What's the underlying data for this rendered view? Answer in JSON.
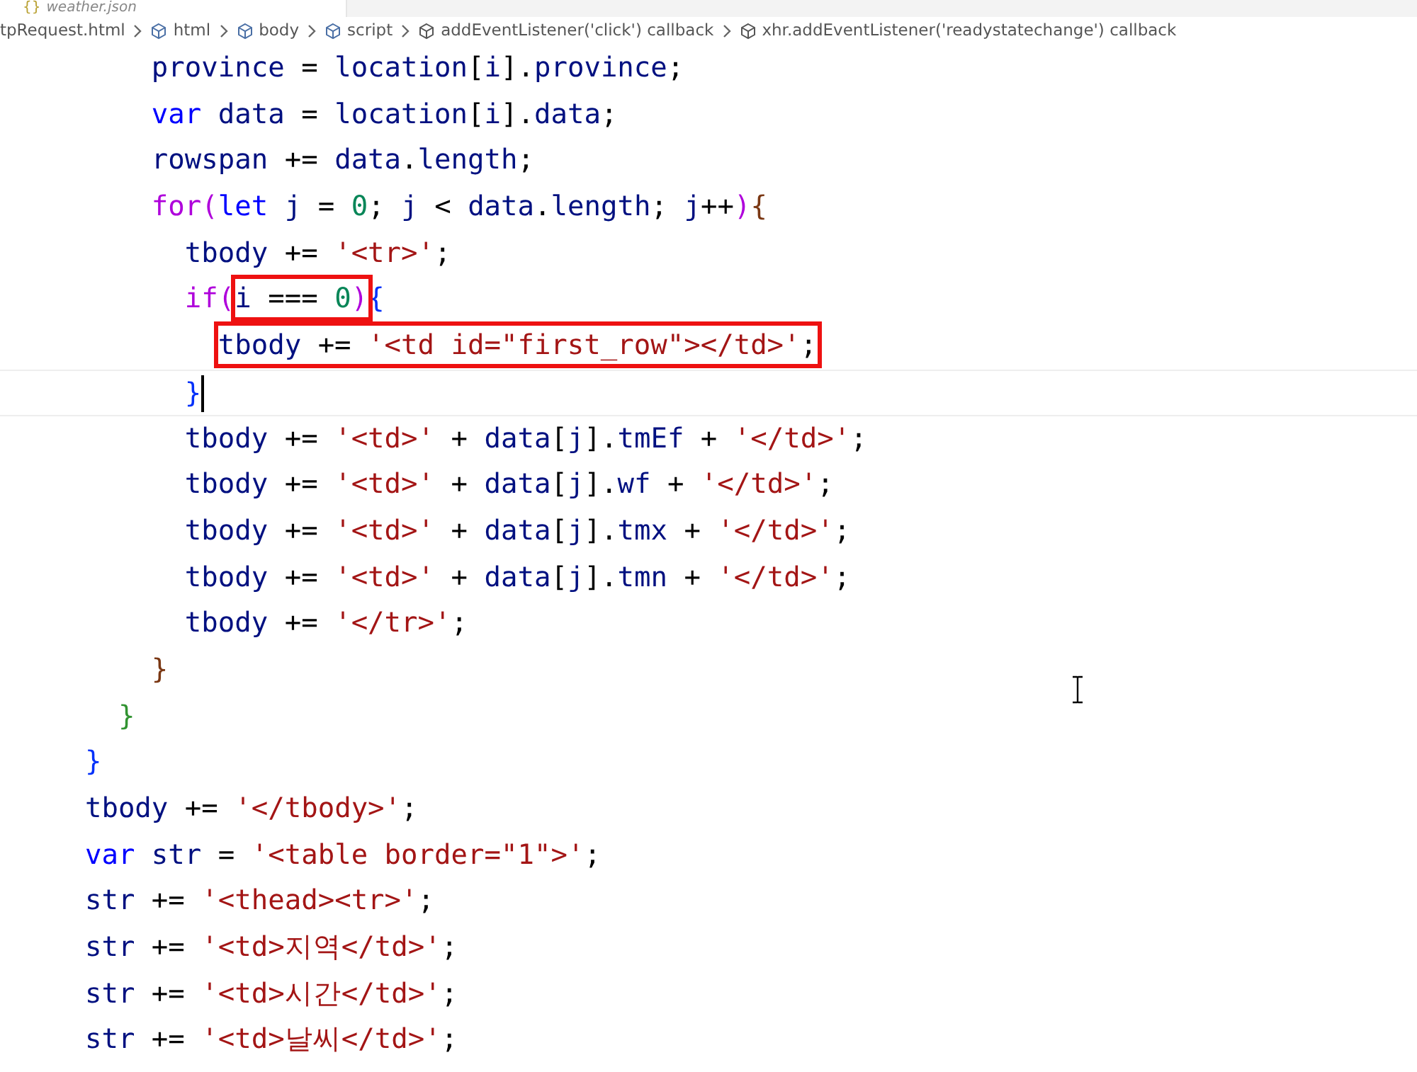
{
  "tab": {
    "icon_text": "{}",
    "label": "weather.json"
  },
  "breadcrumb": [
    {
      "label": "tpRequest.html",
      "kind": "file"
    },
    {
      "label": "html",
      "kind": "symbol"
    },
    {
      "label": "body",
      "kind": "symbol"
    },
    {
      "label": "script",
      "kind": "symbol"
    },
    {
      "label": "addEventListener('click') callback",
      "kind": "method"
    },
    {
      "label": "xhr.addEventListener('readystatechange') callback",
      "kind": "method"
    }
  ],
  "code_lines": [
    {
      "cursor": false,
      "parts": [
        {
          "kind": "id",
          "text": "        province"
        },
        {
          "kind": "op",
          "text": " = "
        },
        {
          "kind": "id",
          "text": "location"
        },
        {
          "kind": "op",
          "text": "["
        },
        {
          "kind": "id",
          "text": "i"
        },
        {
          "kind": "op",
          "text": "]."
        },
        {
          "kind": "id",
          "text": "province"
        },
        {
          "kind": "op",
          "text": ";"
        }
      ]
    },
    {
      "cursor": false,
      "parts": [
        {
          "kind": "kw",
          "text": "        var "
        },
        {
          "kind": "id",
          "text": "data"
        },
        {
          "kind": "op",
          "text": " = "
        },
        {
          "kind": "id",
          "text": "location"
        },
        {
          "kind": "op",
          "text": "["
        },
        {
          "kind": "id",
          "text": "i"
        },
        {
          "kind": "op",
          "text": "]."
        },
        {
          "kind": "id",
          "text": "data"
        },
        {
          "kind": "op",
          "text": ";"
        }
      ]
    },
    {
      "cursor": false,
      "parts": [
        {
          "kind": "id",
          "text": "        rowspan"
        },
        {
          "kind": "op",
          "text": " += "
        },
        {
          "kind": "id",
          "text": "data"
        },
        {
          "kind": "op",
          "text": "."
        },
        {
          "kind": "id",
          "text": "length"
        },
        {
          "kind": "op",
          "text": ";"
        }
      ]
    },
    {
      "cursor": false,
      "parts": [
        {
          "kind": "ctl",
          "text": "        for"
        },
        {
          "kind": "b4",
          "text": "("
        },
        {
          "kind": "kw",
          "text": "let "
        },
        {
          "kind": "id",
          "text": "j"
        },
        {
          "kind": "op",
          "text": " = "
        },
        {
          "kind": "num",
          "text": "0"
        },
        {
          "kind": "op",
          "text": "; "
        },
        {
          "kind": "id",
          "text": "j"
        },
        {
          "kind": "op",
          "text": " < "
        },
        {
          "kind": "id",
          "text": "data"
        },
        {
          "kind": "op",
          "text": "."
        },
        {
          "kind": "id",
          "text": "length"
        },
        {
          "kind": "op",
          "text": "; "
        },
        {
          "kind": "id",
          "text": "j"
        },
        {
          "kind": "op",
          "text": "++"
        },
        {
          "kind": "b4",
          "text": ")"
        },
        {
          "kind": "b3",
          "text": "{"
        }
      ]
    },
    {
      "cursor": false,
      "parts": [
        {
          "kind": "id",
          "text": "          tbody"
        },
        {
          "kind": "op",
          "text": " += "
        },
        {
          "kind": "str",
          "text": "'<tr>'"
        },
        {
          "kind": "op",
          "text": ";"
        }
      ]
    },
    {
      "cursor": false,
      "parts": [
        {
          "kind": "ctl",
          "text": "          if"
        },
        {
          "kind": "b4",
          "text": "("
        },
        {
          "kind": "boxed",
          "parts": [
            {
              "kind": "id",
              "text": "i"
            },
            {
              "kind": "op",
              "text": " === "
            },
            {
              "kind": "num",
              "text": "0"
            },
            {
              "kind": "b4",
              "text": ")"
            }
          ]
        },
        {
          "kind": "b1",
          "text": "{"
        }
      ]
    },
    {
      "cursor": false,
      "parts": [
        {
          "kind": "boxed",
          "parts": [
            {
              "kind": "id",
              "text": "tbody"
            },
            {
              "kind": "op",
              "text": " += "
            },
            {
              "kind": "str",
              "text": "'<td id=\"first_row\"></td>'"
            },
            {
              "kind": "op",
              "text": ";"
            }
          ]
        }
      ]
    },
    {
      "cursor": true,
      "parts": [
        {
          "kind": "b1",
          "text": "          }"
        }
      ]
    },
    {
      "cursor": false,
      "parts": [
        {
          "kind": "id",
          "text": "          tbody"
        },
        {
          "kind": "op",
          "text": " += "
        },
        {
          "kind": "str",
          "text": "'<td>'"
        },
        {
          "kind": "op",
          "text": " + "
        },
        {
          "kind": "id",
          "text": "data"
        },
        {
          "kind": "op",
          "text": "["
        },
        {
          "kind": "id",
          "text": "j"
        },
        {
          "kind": "op",
          "text": "]."
        },
        {
          "kind": "id",
          "text": "tmEf"
        },
        {
          "kind": "op",
          "text": " + "
        },
        {
          "kind": "str",
          "text": "'</td>'"
        },
        {
          "kind": "op",
          "text": ";"
        }
      ]
    },
    {
      "cursor": false,
      "parts": [
        {
          "kind": "id",
          "text": "          tbody"
        },
        {
          "kind": "op",
          "text": " += "
        },
        {
          "kind": "str",
          "text": "'<td>'"
        },
        {
          "kind": "op",
          "text": " + "
        },
        {
          "kind": "id",
          "text": "data"
        },
        {
          "kind": "op",
          "text": "["
        },
        {
          "kind": "id",
          "text": "j"
        },
        {
          "kind": "op",
          "text": "]."
        },
        {
          "kind": "id",
          "text": "wf"
        },
        {
          "kind": "op",
          "text": " + "
        },
        {
          "kind": "str",
          "text": "'</td>'"
        },
        {
          "kind": "op",
          "text": ";"
        }
      ]
    },
    {
      "cursor": false,
      "parts": [
        {
          "kind": "id",
          "text": "          tbody"
        },
        {
          "kind": "op",
          "text": " += "
        },
        {
          "kind": "str",
          "text": "'<td>'"
        },
        {
          "kind": "op",
          "text": " + "
        },
        {
          "kind": "id",
          "text": "data"
        },
        {
          "kind": "op",
          "text": "["
        },
        {
          "kind": "id",
          "text": "j"
        },
        {
          "kind": "op",
          "text": "]."
        },
        {
          "kind": "id",
          "text": "tmx"
        },
        {
          "kind": "op",
          "text": " + "
        },
        {
          "kind": "str",
          "text": "'</td>'"
        },
        {
          "kind": "op",
          "text": ";"
        }
      ]
    },
    {
      "cursor": false,
      "parts": [
        {
          "kind": "id",
          "text": "          tbody"
        },
        {
          "kind": "op",
          "text": " += "
        },
        {
          "kind": "str",
          "text": "'<td>'"
        },
        {
          "kind": "op",
          "text": " + "
        },
        {
          "kind": "id",
          "text": "data"
        },
        {
          "kind": "op",
          "text": "["
        },
        {
          "kind": "id",
          "text": "j"
        },
        {
          "kind": "op",
          "text": "]."
        },
        {
          "kind": "id",
          "text": "tmn"
        },
        {
          "kind": "op",
          "text": " + "
        },
        {
          "kind": "str",
          "text": "'</td>'"
        },
        {
          "kind": "op",
          "text": ";"
        }
      ]
    },
    {
      "cursor": false,
      "parts": [
        {
          "kind": "id",
          "text": "          tbody"
        },
        {
          "kind": "op",
          "text": " += "
        },
        {
          "kind": "str",
          "text": "'</tr>'"
        },
        {
          "kind": "op",
          "text": ";"
        }
      ]
    },
    {
      "cursor": false,
      "parts": [
        {
          "kind": "b3",
          "text": "        }"
        }
      ]
    },
    {
      "cursor": false,
      "parts": [
        {
          "kind": "b2",
          "text": "      }"
        }
      ]
    },
    {
      "cursor": false,
      "parts": [
        {
          "kind": "b1",
          "text": "    }"
        }
      ]
    },
    {
      "cursor": false,
      "parts": [
        {
          "kind": "id",
          "text": "    tbody"
        },
        {
          "kind": "op",
          "text": " += "
        },
        {
          "kind": "str",
          "text": "'</tbody>'"
        },
        {
          "kind": "op",
          "text": ";"
        }
      ]
    },
    {
      "cursor": false,
      "parts": [
        {
          "kind": "kw",
          "text": "    var "
        },
        {
          "kind": "id",
          "text": "str"
        },
        {
          "kind": "op",
          "text": " = "
        },
        {
          "kind": "str",
          "text": "'<table border=\"1\">'"
        },
        {
          "kind": "op",
          "text": ";"
        }
      ]
    },
    {
      "cursor": false,
      "parts": [
        {
          "kind": "id",
          "text": "    str"
        },
        {
          "kind": "op",
          "text": " += "
        },
        {
          "kind": "str",
          "text": "'<thead><tr>'"
        },
        {
          "kind": "op",
          "text": ";"
        }
      ]
    },
    {
      "cursor": false,
      "parts": [
        {
          "kind": "id",
          "text": "    str"
        },
        {
          "kind": "op",
          "text": " += "
        },
        {
          "kind": "str",
          "text": "'<td>지역</td>'"
        },
        {
          "kind": "op",
          "text": ";"
        }
      ]
    },
    {
      "cursor": false,
      "parts": [
        {
          "kind": "id",
          "text": "    str"
        },
        {
          "kind": "op",
          "text": " += "
        },
        {
          "kind": "str",
          "text": "'<td>시간</td>'"
        },
        {
          "kind": "op",
          "text": ";"
        }
      ]
    },
    {
      "cursor": false,
      "parts": [
        {
          "kind": "id",
          "text": "    str"
        },
        {
          "kind": "op",
          "text": " += "
        },
        {
          "kind": "str",
          "text": "'<td>날씨</td>'"
        },
        {
          "kind": "op",
          "text": ";"
        }
      ]
    }
  ]
}
